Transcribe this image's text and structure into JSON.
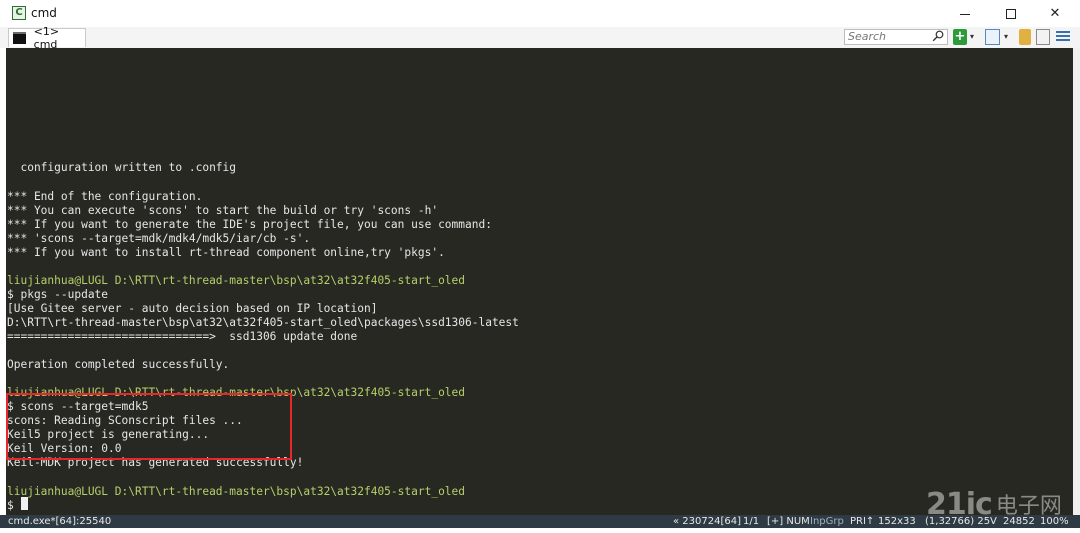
{
  "window": {
    "title": "cmd",
    "app_icon": "conemu-icon",
    "minimize_glyph": "—",
    "maximize_glyph": "☐",
    "close_glyph": "✕"
  },
  "tabs": [
    {
      "label": "<1> cmd",
      "icon": "console-icon"
    }
  ],
  "toolbar": {
    "search_placeholder": "Search",
    "add_glyph": "+",
    "dropdown_glyph": "▾"
  },
  "terminal": {
    "lines": [
      {
        "row": 8,
        "kind": "text",
        "text": "  configuration written to .config"
      },
      {
        "row": 10,
        "kind": "text",
        "text": "*** End of the configuration."
      },
      {
        "row": 11,
        "kind": "text",
        "text": "*** You can execute 'scons' to start the build or try 'scons -h'"
      },
      {
        "row": 12,
        "kind": "text",
        "text": "*** If you want to generate the IDE's project file, you can use command:"
      },
      {
        "row": 13,
        "kind": "text",
        "text": "*** 'scons --target=mdk/mdk4/mdk5/iar/cb -s'."
      },
      {
        "row": 14,
        "kind": "text",
        "text": "*** If you want to install rt-thread component online,try 'pkgs'."
      },
      {
        "row": 16,
        "kind": "prompt",
        "text": "liujianhua@LUGL D:\\RTT\\rt-thread-master\\bsp\\at32\\at32f405-start_oled"
      },
      {
        "row": 17,
        "kind": "text",
        "text": "$ pkgs --update"
      },
      {
        "row": 18,
        "kind": "text",
        "text": "[Use Gitee server - auto decision based on IP location]"
      },
      {
        "row": 19,
        "kind": "text",
        "text": "D:\\RTT\\rt-thread-master\\bsp\\at32\\at32f405-start_oled\\packages\\ssd1306-latest"
      },
      {
        "row": 20,
        "kind": "text",
        "text": "==============================>  ssd1306 update done"
      },
      {
        "row": 22,
        "kind": "text",
        "text": "Operation completed successfully."
      },
      {
        "row": 24,
        "kind": "prompt",
        "text": "liujianhua@LUGL D:\\RTT\\rt-thread-master\\bsp\\at32\\at32f405-start_oled"
      },
      {
        "row": 25,
        "kind": "text",
        "text": "$ scons --target=mdk5"
      },
      {
        "row": 26,
        "kind": "text",
        "text": "scons: Reading SConscript files ..."
      },
      {
        "row": 27,
        "kind": "text",
        "text": "Keil5 project is generating..."
      },
      {
        "row": 28,
        "kind": "text",
        "text": "Keil Version: 0.0"
      },
      {
        "row": 29,
        "kind": "text",
        "text": "Keil-MDK project has generated successfully!"
      },
      {
        "row": 31,
        "kind": "prompt",
        "text": "liujianhua@LUGL D:\\RTT\\rt-thread-master\\bsp\\at32\\at32f405-start_oled"
      },
      {
        "row": 32,
        "kind": "text",
        "text": "$ "
      }
    ],
    "colors": {
      "background": "#272822",
      "text": "#e6e6e6",
      "prompt": "#b5cf6b",
      "highlight_box": "#e8272c"
    }
  },
  "statusbar": {
    "process": "cmd.exe*[64]:25540",
    "position": "« 230724[64]",
    "page": "1/1",
    "mode": "[+] NUM",
    "group": "InpGrp",
    "priority": "PRI↑",
    "size": "152x33",
    "pid": "(1,32766) 25V",
    "cpu": "24852",
    "zoom": "100%"
  },
  "watermark": {
    "logo": "21ic",
    "text": "电子网"
  }
}
